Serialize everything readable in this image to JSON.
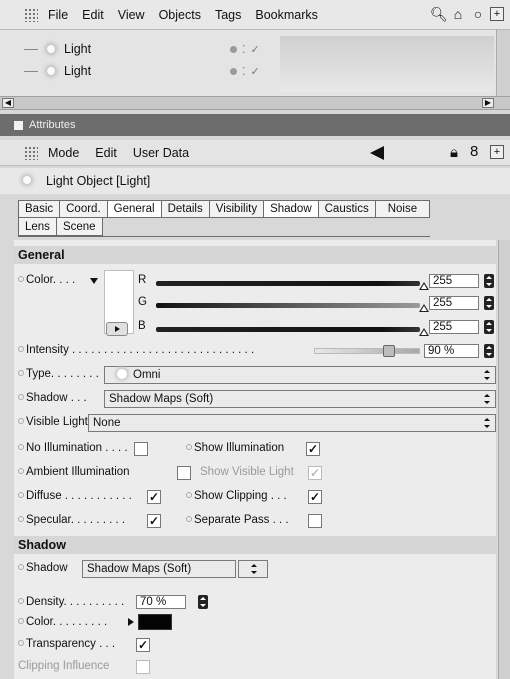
{
  "object_manager": {
    "menu": [
      "File",
      "Edit",
      "View",
      "Objects",
      "Tags",
      "Bookmarks"
    ],
    "tool_icons": [
      "search-icon",
      "home-icon",
      "ellipse-icon",
      "expand-icon"
    ],
    "objects": [
      {
        "name": "Light",
        "icon": "light-icon"
      },
      {
        "name": "Light",
        "icon": "light-icon"
      }
    ]
  },
  "attributes": {
    "panel_title": "Attributes",
    "menu": [
      "Mode",
      "Edit",
      "User Data"
    ],
    "object_title": "Light Object [Light]",
    "tabs_row1": [
      "Basic",
      "Coord.",
      "General",
      "Details",
      "Visibility",
      "Shadow",
      "Caustics",
      "Noise"
    ],
    "tabs_row2": [
      "Lens",
      "Scene"
    ],
    "active_tab": "General"
  },
  "general": {
    "heading": "General",
    "color_label": "Color. . . .",
    "r_label": "R",
    "g_label": "G",
    "b_label": "B",
    "r_value": "255",
    "g_value": "255",
    "b_value": "255",
    "intensity_label": "Intensity . . . . . . . . . . . . . . . . . . . . . . . . . . . . .",
    "intensity_value": "90 %",
    "intensity_level": 0.9,
    "type_label": "Type. . . . . . . .",
    "type_value": "Omni",
    "shadow_label": "Shadow . . .",
    "shadow_value": "Shadow Maps (Soft)",
    "visible_light_label": "Visible Light",
    "visible_light_value": "None",
    "checks_left": [
      {
        "label": "No Illumination . . . .",
        "checked": false
      },
      {
        "label": "Ambient Illumination",
        "checked": false
      },
      {
        "label": "Diffuse . . . . . . . . . . .",
        "checked": true
      },
      {
        "label": "Specular. . . . . . . . .",
        "checked": true
      }
    ],
    "checks_right": [
      {
        "label": "Show Illumination",
        "checked": true,
        "disabled": false
      },
      {
        "label": "Show Visible Light",
        "checked": true,
        "disabled": true
      },
      {
        "label": "Show Clipping . . .",
        "checked": true,
        "disabled": false
      },
      {
        "label": "Separate Pass . . .",
        "checked": false,
        "disabled": false
      }
    ]
  },
  "shadow": {
    "heading": "Shadow",
    "shadow_label": "Shadow",
    "shadow_value": "Shadow Maps (Soft)",
    "density_label": "Density. . . . . . . . . .",
    "density_value": "70 %",
    "color_label": "Color. . . . . . . . .",
    "color_hex": "#050505",
    "transparency_label": "Transparency . . .",
    "transparency_checked": true,
    "clipping_label": "Clipping Influence",
    "clipping_checked": false
  }
}
